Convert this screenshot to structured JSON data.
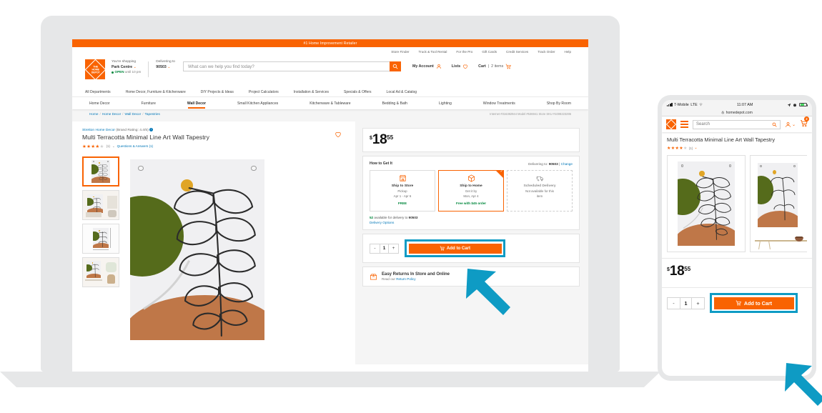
{
  "desktop": {
    "promo_banner": "#1 Home Improvement Retailer",
    "utility_links": [
      "Store Finder",
      "Truck & Tool Rental",
      "For the Pro",
      "Gift Cards",
      "Credit Services",
      "Track Order",
      "Help"
    ],
    "logo_text": "THE HOME DEPOT",
    "shopping": {
      "label": "You're shopping",
      "store": "Park Centre",
      "open_status": "OPEN",
      "open_until": "until 10 pm"
    },
    "delivering": {
      "label": "Delivering to",
      "zip": "90503"
    },
    "search": {
      "placeholder": "What can we help you find today?",
      "icon": "search-icon"
    },
    "account": {
      "my_account": "My Account",
      "lists": "Lists",
      "cart": "Cart",
      "cart_count": "2 items"
    },
    "departments": [
      "All Departments",
      "Home Decor, Furniture & Kitchenware",
      "DIY Projects & Ideas",
      "Project Calculators",
      "Installation & Services",
      "Specials & Offers",
      "Local Ad & Catalog"
    ],
    "categories": [
      {
        "label": "Home Decor",
        "active": false
      },
      {
        "label": "Furniture",
        "active": false
      },
      {
        "label": "Wall Decor",
        "active": true
      },
      {
        "label": "Small Kitchen Appliances",
        "active": false
      },
      {
        "label": "Kitchenware & Tableware",
        "active": false
      },
      {
        "label": "Bedding & Bath",
        "active": false
      },
      {
        "label": "Lighting",
        "active": false
      },
      {
        "label": "Window Treatments",
        "active": false
      },
      {
        "label": "Shop By Room",
        "active": false
      }
    ],
    "breadcrumb": [
      "Home",
      "Home Decor",
      "Wall Decor",
      "Tapestries"
    ],
    "ids": "Internet #316382944   Model #536941   Store SKU #1008223286",
    "product": {
      "brand": "Stretton Home Decor",
      "brand_rating": "(Brand Rating: 4.4/5)",
      "title": "Multi Terracotta Minimal Line Art Wall Tapestry",
      "stars": 4,
      "review_count": "(1)",
      "qa_link": "Questions & Answers (1)",
      "price_currency": "$",
      "price_whole": "18",
      "price_cents": "55"
    },
    "how_to_get_it": {
      "heading": "How to Get It",
      "delivering_to_label": "Delivering to:",
      "delivering_to_zip": "90503",
      "change_link": "Change",
      "options": [
        {
          "name": "Ship to Store",
          "line1": "Pickup",
          "line2": "Apr 1 - Apr 6",
          "price": "FREE",
          "state": "available",
          "icon": "store-box-icon"
        },
        {
          "name": "Ship to Home",
          "line1": "Get it by",
          "line2": "Mon, Apr 4",
          "price": "Free with $45 order",
          "state": "selected",
          "icon": "package-icon"
        },
        {
          "name": "Scheduled Delivery",
          "line1": "Not available for this",
          "line2": "item",
          "price": "",
          "state": "disabled",
          "icon": "truck-icon"
        }
      ],
      "availability_count": "52",
      "availability_text": "available for delivery to",
      "availability_zip": "90503",
      "delivery_options_link": "Delivery Options"
    },
    "cart_actions": {
      "decrement": "-",
      "quantity": "1",
      "increment": "+",
      "add_to_cart": "Add to Cart",
      "cart_icon": "shopping-cart-icon"
    },
    "returns": {
      "icon": "return-box-icon",
      "title": "Easy Returns In Store and Online",
      "subtitle_prefix": "Read our ",
      "subtitle_link": "Return Policy"
    }
  },
  "mobile": {
    "status_bar": {
      "carrier": "T-Mobile",
      "network": "LTE",
      "time": "11:07 AM",
      "wifi_icon": "wifi-icon",
      "location_icon": "location-arrow-icon",
      "alarm_icon": "alarm-icon",
      "battery_icon": "battery-icon"
    },
    "url_bar": {
      "lock_icon": "lock-icon",
      "url": "homedepot.com"
    },
    "header": {
      "logo": "home-depot-logo",
      "menu_icon": "hamburger-menu-icon",
      "search_placeholder": "Search",
      "search_icon": "search-icon",
      "account_icon": "account-icon",
      "cart_icon": "shopping-cart-icon",
      "cart_badge": "2"
    },
    "product": {
      "title": "Multi Terracotta Minimal Line Art Wall Tapestry",
      "stars": 4,
      "review_count": "(1)",
      "price_currency": "$",
      "price_whole": "18",
      "price_cents": "55"
    },
    "cart_actions": {
      "decrement": "-",
      "quantity": "1",
      "increment": "+",
      "add_to_cart": "Add to Cart",
      "cart_icon": "shopping-cart-icon"
    }
  },
  "annotations": {
    "highlight_color": "#0e9bc4",
    "brand_color": "#f96302",
    "arrow_desktop": "arrow-pointing-to-desktop-add-to-cart",
    "arrow_mobile": "arrow-pointing-to-mobile-add-to-cart"
  }
}
